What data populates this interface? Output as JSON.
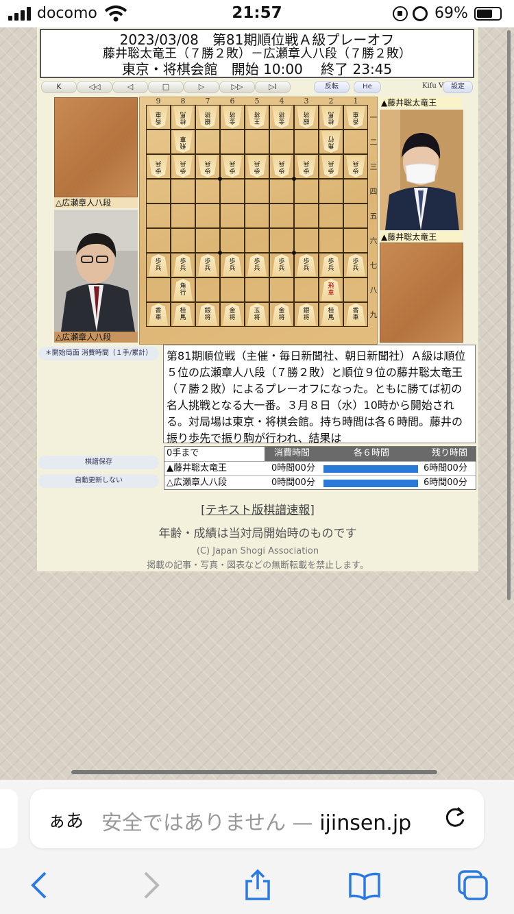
{
  "status": {
    "carrier": "docomo",
    "time": "21:57",
    "battery": "69%"
  },
  "header": {
    "line1": "2023/03/08　第81期順位戦Ａ級プレーオフ",
    "line2": "藤井聡太竜王（７勝２敗）－広瀬章人八段（７勝２敗）",
    "line3": "東京・将棋会館　開始 10:00　 終了 23:45"
  },
  "toolbar": {
    "nav": [
      "K",
      "◁◁",
      "◁",
      "□",
      "▷",
      "▷▷",
      "▷I"
    ],
    "flip": "反転",
    "he": "He",
    "version": "Kifu V1.01",
    "settings": "設定"
  },
  "players": {
    "gote_top_label": "△広瀬章人八段",
    "gote_photo_label": "△広瀬章人八段",
    "sente_top_label": "▲藤井聡太竜王",
    "sente_stand_label": "▲藤井聡太竜王"
  },
  "board": {
    "files": [
      "9",
      "8",
      "7",
      "6",
      "5",
      "4",
      "3",
      "2",
      "1"
    ],
    "ranks": [
      "一",
      "二",
      "三",
      "四",
      "五",
      "六",
      "七",
      "八",
      "九"
    ],
    "gote_back": [
      "香車",
      "桂馬",
      "銀将",
      "金将",
      "王将",
      "金将",
      "銀将",
      "桂馬",
      "香車"
    ],
    "gote_rook": "飛車",
    "gote_bishop": "角行",
    "pawn": "歩兵",
    "sente_back": [
      "香車",
      "桂馬",
      "銀将",
      "金将",
      "玉将",
      "金将",
      "銀将",
      "桂馬",
      "香車"
    ],
    "sente_rook": "飛車",
    "sente_bishop": "角行"
  },
  "comment": "第81期順位戦（主催・毎日新聞社、朝日新聞社）Ａ級は順位５位の広瀬章人八段（７勝２敗）と順位９位の藤井聡太竜王（７勝２敗）によるプレーオフになった。ともに勝てば初の名人挑戦となる大一番。３月８日（水）10時から開始される。対局場は東京・将棋会館。持ち時間は各６時間。藤井の振り歩先で振り駒が行われ、結果は",
  "side": {
    "moves_header": "＊開始局面 消費時間（１手/累計）",
    "save": "棋譜保存",
    "auto_update": "自動更新しない"
  },
  "time_table": {
    "moves": "0手まで",
    "col_used": "消費時間",
    "col_each": "各６時間",
    "col_remaining": "残り時間",
    "rows": [
      {
        "name": "▲藤井聡太竜王",
        "used": "0時間00分",
        "remaining": "6時間00分",
        "remaining_fraction": 1.0
      },
      {
        "name": "△広瀬章人八段",
        "used": "0時間00分",
        "remaining": "6時間00分",
        "remaining_fraction": 1.0
      }
    ]
  },
  "footer": {
    "link": "[テキスト版棋譜速報]",
    "note": "年齢・成績は当対局開始時のものです",
    "copyright": "(C) Japan Shogi Association",
    "notice": "掲載の記事・写真・図表などの無断転載を禁止します。"
  },
  "browser": {
    "aa": "ぁあ",
    "url_insecure": "安全ではありません — ",
    "url_domain": "ijinsen.jp"
  },
  "icons": {
    "back": "back-icon",
    "forward": "forward-icon",
    "share": "share-icon",
    "bookmarks": "bookmarks-icon",
    "tabs": "tabs-icon",
    "reload": "reload-icon"
  }
}
